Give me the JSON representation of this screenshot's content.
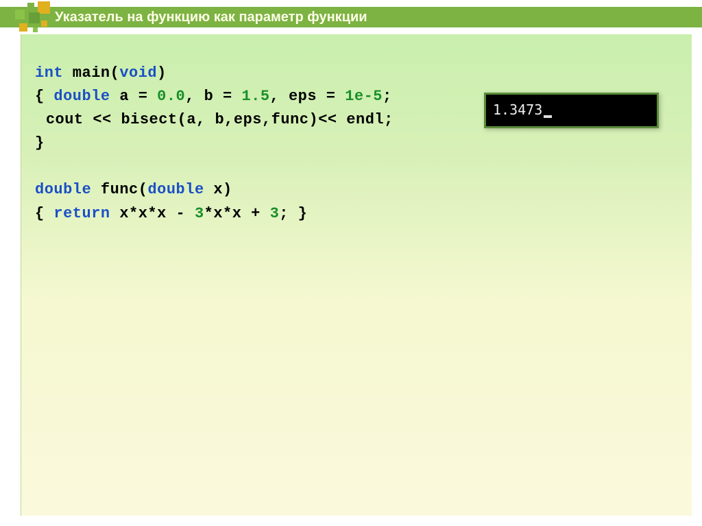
{
  "header": {
    "title": "Указатель на функцию как параметр функции"
  },
  "output": {
    "value": "1.3473"
  },
  "code": {
    "l1_kw_int": "int",
    "l1_main": " main(",
    "l1_kw_void": "void",
    "l1_close": ")",
    "l2_open": "{ ",
    "l2_kw_double": "double",
    "l2_a_eq": " a = ",
    "l2_v0": "0.0",
    "l2_comma_b": ", b = ",
    "l2_v15": "1.5",
    "l2_comma_eps": ", eps = ",
    "l2_v1e5": "1e-5",
    "l2_semi": ";",
    "l3_body": "cout << bisect(a, b,eps,func)<< endl;",
    "l4_close": "}",
    "l6_kw_double": "double",
    "l6_func": " func(",
    "l6_kw_double2": "double",
    "l6_x": " x)",
    "l7_open": "{ ",
    "l7_kw_return": "return",
    "l7_expr1": " x*x*x - ",
    "l7_n3a": "3",
    "l7_expr2": "*x*x + ",
    "l7_n3b": "3",
    "l7_tail": "; }"
  }
}
